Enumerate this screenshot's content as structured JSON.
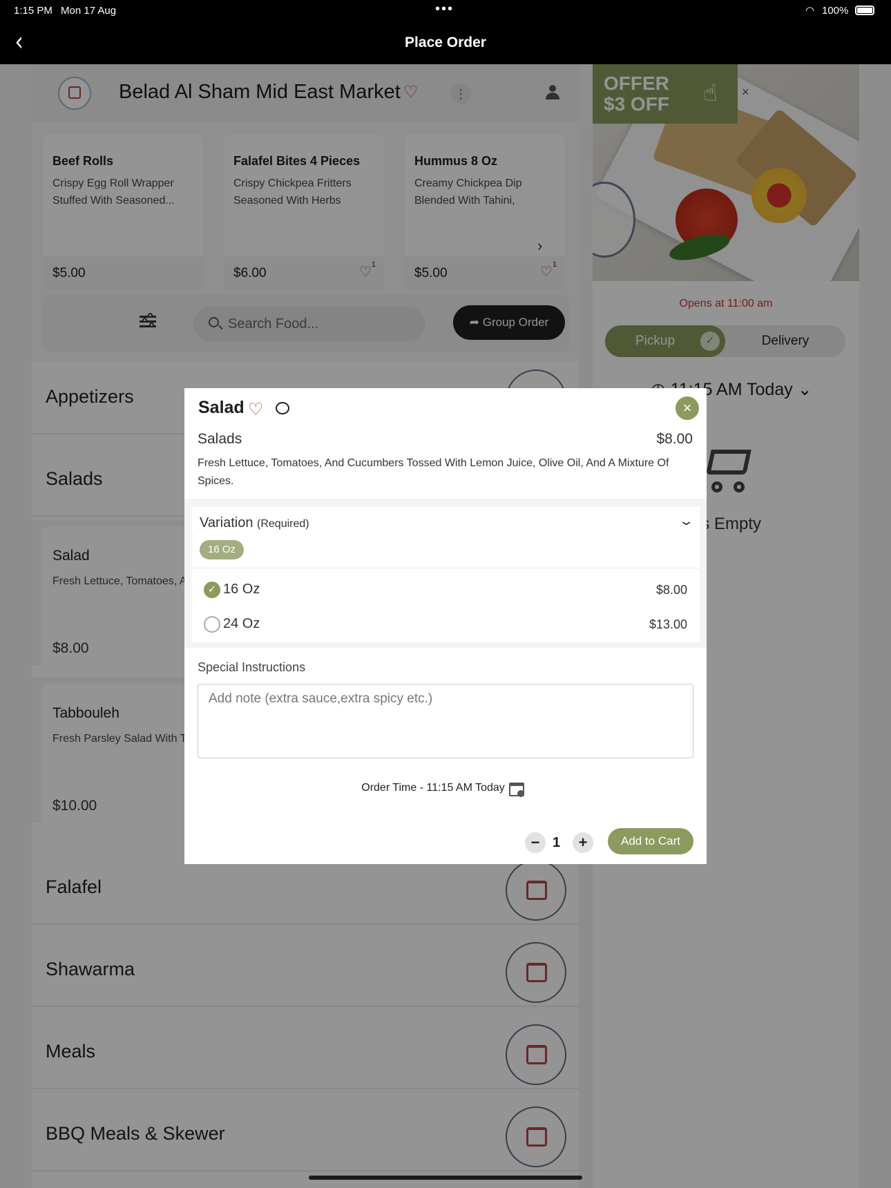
{
  "status_bar": {
    "time": "1:15 PM",
    "date": "Mon 17 Aug",
    "battery": "100%"
  },
  "nav": {
    "title": "Place Order"
  },
  "store": {
    "name": "Belad Al Sham Mid East Market"
  },
  "featured": [
    {
      "name": "Beef Rolls",
      "desc": "Crispy Egg Roll Wrapper Stuffed With Seasoned...",
      "price": "$5.00",
      "likes": ""
    },
    {
      "name": "Falafel Bites 4 Pieces",
      "desc": "Crispy Chickpea Fritters Seasoned With Herbs And...",
      "price": "$6.00",
      "likes": "1"
    },
    {
      "name": "Hummus 8 Oz",
      "desc": "Creamy Chickpea Dip Blended With Tahini, Garli...",
      "price": "$5.00",
      "likes": "1"
    }
  ],
  "search": {
    "placeholder": "Search Food...",
    "group_order": "Group Order"
  },
  "categories": [
    "Appetizers",
    "Salads",
    "Falafel",
    "Shawarma",
    "Meals",
    "BBQ Meals & Skewer"
  ],
  "salad_items": [
    {
      "name": "Salad",
      "desc": "Fresh Lettuce, Tomatoes, A Spices.",
      "price": "$8.00"
    },
    {
      "name": "Tabbouleh",
      "desc": "Fresh Parsley Salad With T",
      "price": "$10.00"
    }
  ],
  "promo": {
    "line1": "OFFER",
    "line2": "$3 OFF",
    "close": "×"
  },
  "side": {
    "opens": "Opens at 11:00 am",
    "pickup": "Pickup",
    "delivery": "Delivery",
    "time": "11:15 AM Today",
    "cart_empty": "Cart is Empty"
  },
  "modal": {
    "title": "Salad",
    "category": "Salads",
    "price": "$8.00",
    "description": "Fresh Lettuce, Tomatoes, And Cucumbers Tossed With Lemon Juice, Olive Oil, And A Mixture Of Spices.",
    "variation_label": "Variation",
    "variation_required": "(Required)",
    "selected_chip": "16 Oz",
    "options": [
      {
        "name": "16 Oz",
        "price": "$8.00",
        "selected": true
      },
      {
        "name": "24 Oz",
        "price": "$13.00",
        "selected": false
      }
    ],
    "special_label": "Special Instructions",
    "special_placeholder": "Add note (extra sauce,extra spicy etc.)",
    "order_time": "Order Time - 11:15 AM Today",
    "quantity": "1",
    "add_to_cart": "Add to Cart"
  },
  "colors": {
    "accent": "#8b9a5d",
    "heart": "#dd3333",
    "sale": "#cc3333"
  }
}
